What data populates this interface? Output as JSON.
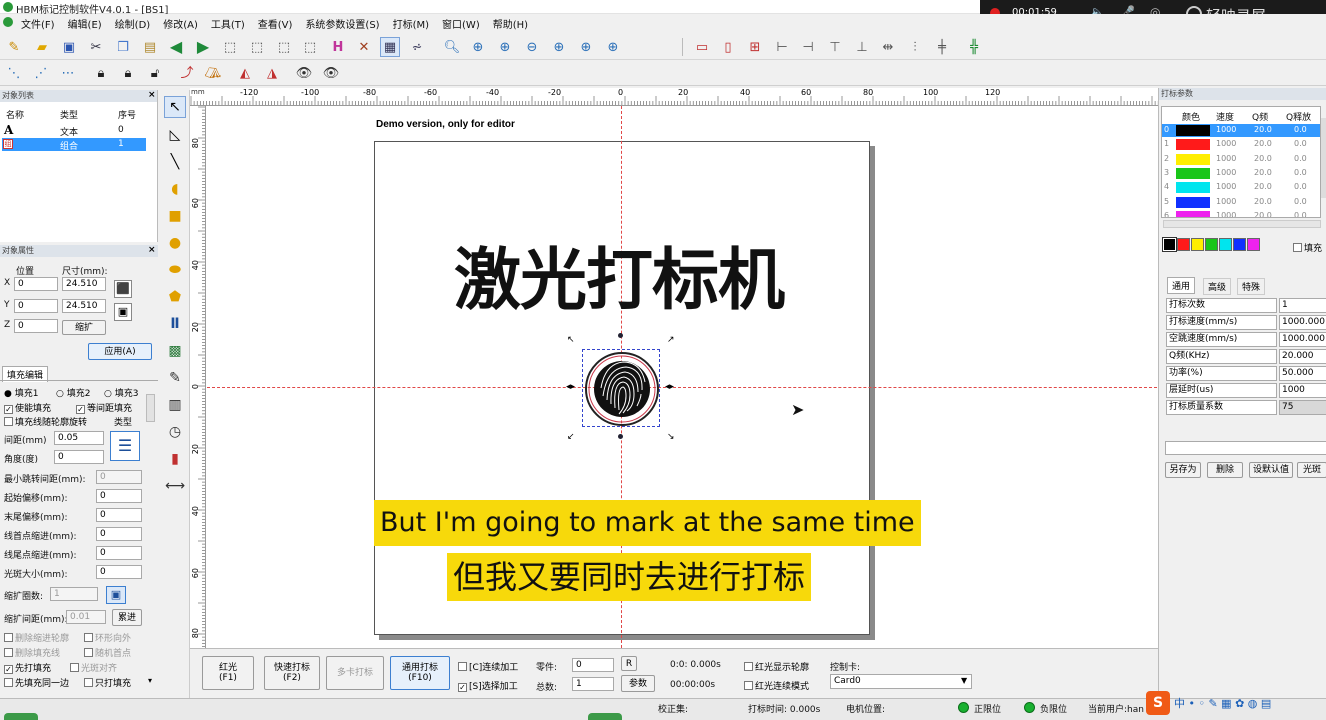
{
  "app_title": "HBM标记控制软件V4.0.1 - [BS1]",
  "recording": {
    "time": "00:01:59",
    "brand": "轻映录屏"
  },
  "menu": [
    "文件(F)",
    "编辑(E)",
    "绘制(D)",
    "修改(A)",
    "工具(T)",
    "查看(V)",
    "系统参数设置(S)",
    "打标(M)",
    "窗口(W)",
    "帮助(H)"
  ],
  "object_list": {
    "title": "对象列表",
    "headers": [
      "名称",
      "类型",
      "序号"
    ],
    "rows": [
      {
        "icon": "A",
        "type": "文本",
        "index": "0"
      },
      {
        "icon": "组",
        "type": "组合",
        "index": "1"
      }
    ]
  },
  "object_props": {
    "title": "对象属性",
    "pos_label": "位置",
    "size_label": "尺寸(mm):",
    "x_label": "X",
    "x_value": "0",
    "w_value": "24.510",
    "y_label": "Y",
    "y_value": "0",
    "h_value": "24.510",
    "z_label": "Z",
    "z_value": "0",
    "scale_btn": "缩扩",
    "apply_btn": "应用(A)"
  },
  "fill": {
    "tab": "填充编辑",
    "radios": [
      "填充1",
      "填充2",
      "填充3"
    ],
    "enable": "使能填充",
    "equidistant": "等间距填充",
    "rotate": "填充线随轮廓旋转",
    "type_label": "类型",
    "spacing_label": "间距(mm)",
    "spacing_value": "0.05",
    "angle_label": "角度(度)",
    "angle_value": "0",
    "fields": [
      {
        "label": "最小跳转间距(mm):",
        "value": "0"
      },
      {
        "label": "起始偏移(mm):",
        "value": "0"
      },
      {
        "label": "末尾偏移(mm):",
        "value": "0"
      },
      {
        "label": "线首点缩进(mm):",
        "value": "0"
      },
      {
        "label": "线尾点缩进(mm):",
        "value": "0"
      },
      {
        "label": "光斑大小(mm):",
        "value": "0"
      }
    ],
    "ring_count_label": "缩扩圈数:",
    "ring_count_value": "1",
    "ring_space_label": "缩扩间距(mm):",
    "ring_space_value": "0.01",
    "accumulate_btn": "累进",
    "options": [
      "删除缩进轮廓",
      "环形向外",
      "删除填充线",
      "随机首点",
      "先打填充",
      "光斑对齐",
      "先填充同一边",
      "只打填充"
    ]
  },
  "canvas": {
    "demo_note": "Demo version, only for editor",
    "main_text": "激光打标机",
    "ruler_h": [
      "-120",
      "-100",
      "-80",
      "-60",
      "-40",
      "-20",
      "0",
      "20",
      "40",
      "60",
      "80",
      "100",
      "120"
    ],
    "ruler_v": [
      "80",
      "60",
      "40",
      "20",
      "0",
      "20",
      "40",
      "60",
      "80"
    ]
  },
  "subtitles": {
    "en": "But I'm going to mark at the same time",
    "zh": "但我又要同时去进行打标"
  },
  "mark_params": {
    "title": "打标参数",
    "headers": [
      "颜色",
      "速度",
      "Q频",
      "Q释放"
    ],
    "rows": [
      {
        "n": "0",
        "color": "#000000",
        "speed": "1000",
        "q": "20.0",
        "qr": "0.0"
      },
      {
        "n": "1",
        "color": "#ff1a1a",
        "speed": "1000",
        "q": "20.0",
        "qr": "0.0"
      },
      {
        "n": "2",
        "color": "#ffee00",
        "speed": "1000",
        "q": "20.0",
        "qr": "0.0"
      },
      {
        "n": "3",
        "color": "#19c619",
        "speed": "1000",
        "q": "20.0",
        "qr": "0.0"
      },
      {
        "n": "4",
        "color": "#00e5ee",
        "speed": "1000",
        "q": "20.0",
        "qr": "0.0"
      },
      {
        "n": "5",
        "color": "#1030ff",
        "speed": "1000",
        "q": "20.0",
        "qr": "0.0"
      },
      {
        "n": "6",
        "color": "#ee22ee",
        "speed": "1000",
        "q": "20.0",
        "qr": "0.0"
      }
    ],
    "swatches": [
      "#000000",
      "#ff1a1a",
      "#ffee00",
      "#19c619",
      "#00e5ee",
      "#1030ff",
      "#ee22ee"
    ],
    "fill_label": "填充",
    "tabs": [
      "通用",
      "高级",
      "特殊"
    ],
    "fields": [
      {
        "label": "打标次数",
        "value": "1"
      },
      {
        "label": "打标速度(mm/s)",
        "value": "1000.000"
      },
      {
        "label": "空跳速度(mm/s)",
        "value": "1000.000"
      },
      {
        "label": "Q频(KHz)",
        "value": "20.000"
      },
      {
        "label": "功率(%)",
        "value": "50.000"
      },
      {
        "label": "层延时(us)",
        "value": "1000"
      },
      {
        "label": "打标质量系数",
        "value": "75"
      }
    ],
    "buttons": [
      "另存为",
      "删除",
      "设默认值",
      "光斑"
    ]
  },
  "bottom": {
    "btn_red": "红光\n(F1)",
    "btn_quick": "快速打标\n(F2)",
    "btn_multi": "多卡打标",
    "btn_general": "通用打标\n(F10)",
    "continuous": "[C]连续加工",
    "selected": "[S]选择加工",
    "part_label": "零件:",
    "part_value": "0",
    "total_label": "总数:",
    "total_value": "1",
    "r_btn": "R",
    "params_btn": "参数",
    "time1": "0:0: 0.000s",
    "time2": "00:00:00s",
    "red_contour": "红光显示轮廓",
    "red_continuous": "红光连续模式",
    "card_label": "控制卡:",
    "card_value": "Card0"
  },
  "status": {
    "calib": "校正集:",
    "mark_time": "打标时间: 0.000s",
    "motor": "电机位置:",
    "pos_limit": "正限位",
    "neg_limit": "负限位",
    "user": "当前用户:han"
  }
}
